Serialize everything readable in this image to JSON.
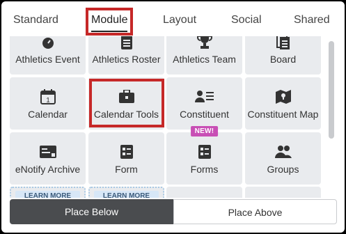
{
  "tabs": [
    {
      "label": "Standard"
    },
    {
      "label": "Module"
    },
    {
      "label": "Layout"
    },
    {
      "label": "Social"
    },
    {
      "label": "Shared"
    }
  ],
  "active_tab": "Module",
  "tiles": [
    {
      "label": "Athletics Event",
      "icon": "stopwatch-icon"
    },
    {
      "label": "Athletics Roster",
      "icon": "clipboard-icon"
    },
    {
      "label": "Athletics Team",
      "icon": "trophy-icon"
    },
    {
      "label": "Board",
      "icon": "documents-icon"
    },
    {
      "label": "Calendar",
      "icon": "calendar-icon"
    },
    {
      "label": "Calendar Tools",
      "icon": "briefcase-icon"
    },
    {
      "label": "Constituent",
      "icon": "contact-card-icon"
    },
    {
      "label": "Constituent Map",
      "icon": "map-pin-icon"
    },
    {
      "label": "eNotify Archive",
      "icon": "archive-card-icon"
    },
    {
      "label": "Form",
      "icon": "form-icon"
    },
    {
      "label": "Forms",
      "icon": "forms-icon",
      "badge": "NEW!"
    },
    {
      "label": "Groups",
      "icon": "group-icon"
    }
  ],
  "partial_tiles": [
    {
      "learn_more": "LEARN MORE"
    },
    {
      "learn_more": "LEARN MORE"
    }
  ],
  "buttons": {
    "place_below": "Place Below",
    "place_above": "Place Above"
  },
  "colors": {
    "highlight": "#c62828",
    "tile_bg": "#e9ebee",
    "badge": "#c84fb5",
    "primary_button": "#4a4c4f"
  }
}
